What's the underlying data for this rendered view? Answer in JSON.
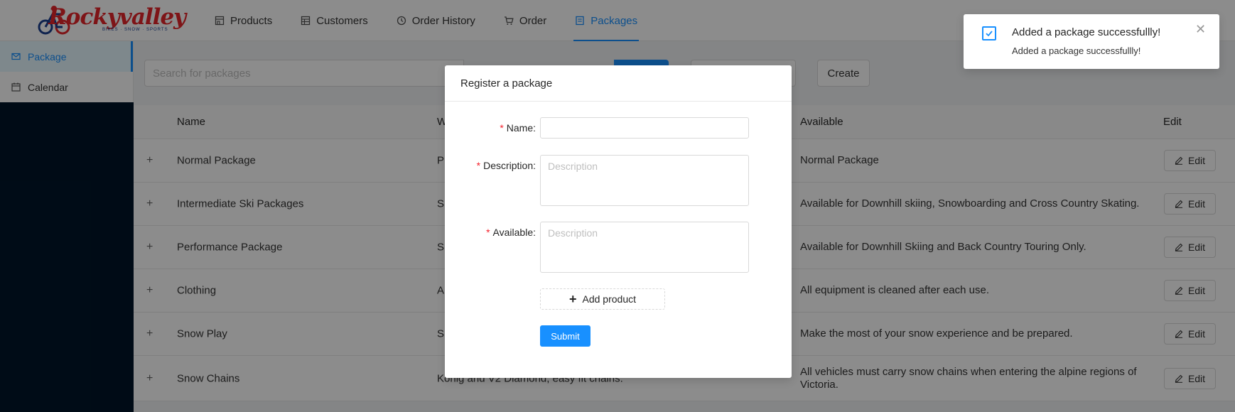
{
  "brand": {
    "logo_text": "Rockyvalley",
    "tagline": "BIKES · SNOW · SPORTS"
  },
  "nav": {
    "items": [
      {
        "label": "Products",
        "icon": "shop-icon"
      },
      {
        "label": "Customers",
        "icon": "table-icon"
      },
      {
        "label": "Order History",
        "icon": "history-icon"
      },
      {
        "label": "Order",
        "icon": "cart-icon"
      },
      {
        "label": "Packages",
        "icon": "file-icon"
      }
    ],
    "active": "Packages"
  },
  "sidebar": {
    "items": [
      {
        "label": "Package",
        "icon": "mail-icon"
      },
      {
        "label": "Calendar",
        "icon": "calendar-icon"
      }
    ]
  },
  "toolbar": {
    "search_placeholder": "Search for packages",
    "create_label": "Create"
  },
  "table": {
    "headers": {
      "name": "Name",
      "what": "W",
      "available": "Available",
      "edit": "Edit"
    },
    "rows": [
      {
        "name": "Normal Package",
        "what": "P",
        "available": "Normal Package",
        "edit": "Edit"
      },
      {
        "name": "Intermediate Ski Packages",
        "what": "S",
        "available": "Available for Downhill skiing, Snowboarding and Cross Country Skating.",
        "edit": "Edit"
      },
      {
        "name": "Performance Package",
        "what": "S",
        "available": "Available for Downhill Skiing and Back Country Touring Only.",
        "edit": "Edit"
      },
      {
        "name": "Clothing",
        "what": "A",
        "available": "All equipment is cleaned after each use.",
        "edit": "Edit"
      },
      {
        "name": "Snow Play",
        "what": "S",
        "available": "Make the most of your snow experience and be prepared.",
        "edit": "Edit"
      },
      {
        "name": "Snow Chains",
        "what": "Konig and V2 Diamond, easy fit chains.",
        "available": "All vehicles must carry snow chains when entering the alpine regions of Victoria.",
        "edit": "Edit"
      }
    ]
  },
  "modal": {
    "title": "Register a package",
    "fields": {
      "name_label": "Name:",
      "description_label": "Description:",
      "description_placeholder": "Description",
      "available_label": "Available:",
      "available_placeholder": "Description"
    },
    "add_product_label": "Add product",
    "submit_label": "Submit"
  },
  "notification": {
    "title": "Added a package successfullly!",
    "description": "Added a package successfullly!"
  },
  "colors": {
    "primary": "#1890ff",
    "required": "#f5222d",
    "sidebar_dark": "#001529",
    "logo_red": "#e5252a"
  }
}
